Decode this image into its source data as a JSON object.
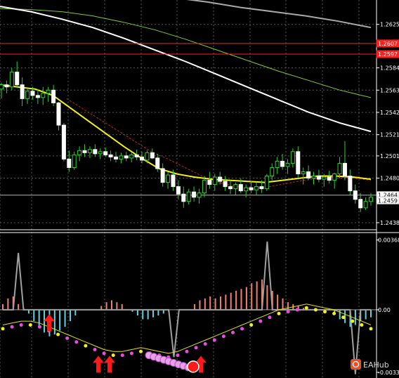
{
  "chart_data": {
    "type": "candlestick",
    "price_axis": {
      "ticks": [
        "1.2625",
        "1.2584",
        "1.2563",
        "1.2542",
        "1.2521",
        "1.2501",
        "1.2480",
        "1.2438"
      ],
      "tick_values": [
        1.2625,
        1.2584,
        1.2563,
        1.2542,
        1.2521,
        1.2501,
        1.248,
        1.2438
      ],
      "range": [
        1.2432,
        1.2648
      ],
      "level_tags": [
        {
          "text": "1.2607",
          "value": 1.2607,
          "color": "#ff2020"
        },
        {
          "text": "1.2597",
          "value": 1.2597,
          "color": "#ff2020"
        },
        {
          "text": "1.2464",
          "value": 1.2464,
          "color": "#ffffff"
        },
        {
          "text": "1.2459",
          "value": 1.2459,
          "color": "#ffffff"
        }
      ]
    },
    "indicator_axis": {
      "ticks": [
        "0.00368",
        "0.00",
        "-0.0033"
      ],
      "tick_values": [
        0.00368,
        0.0,
        -0.0033
      ],
      "range": [
        -0.0036,
        0.004
      ]
    },
    "candles": [
      [
        1.2564,
        1.257,
        1.2555,
        1.2568
      ],
      [
        1.2568,
        1.2572,
        1.256,
        1.2566
      ],
      [
        1.2566,
        1.2584,
        1.2563,
        1.258
      ],
      [
        1.258,
        1.259,
        1.2565,
        1.2568
      ],
      [
        1.2568,
        1.2575,
        1.2548,
        1.2555
      ],
      [
        1.2555,
        1.2565,
        1.255,
        1.2562
      ],
      [
        1.2562,
        1.2566,
        1.2554,
        1.2558
      ],
      [
        1.2558,
        1.2564,
        1.255,
        1.2556
      ],
      [
        1.2556,
        1.2566,
        1.2549,
        1.256
      ],
      [
        1.256,
        1.2566,
        1.2552,
        1.2563
      ],
      [
        1.2563,
        1.2568,
        1.2548,
        1.2551
      ],
      [
        1.2551,
        1.2552,
        1.2525,
        1.253
      ],
      [
        1.253,
        1.2532,
        1.2496,
        1.2498
      ],
      [
        1.2498,
        1.2506,
        1.2486,
        1.249
      ],
      [
        1.249,
        1.2505,
        1.2488,
        1.2502
      ],
      [
        1.2502,
        1.251,
        1.2496,
        1.2506
      ],
      [
        1.2506,
        1.2512,
        1.25,
        1.2504
      ],
      [
        1.2504,
        1.251,
        1.2499,
        1.2507
      ],
      [
        1.2507,
        1.2512,
        1.25,
        1.2503
      ],
      [
        1.2503,
        1.2508,
        1.2498,
        1.2505
      ],
      [
        1.2505,
        1.2509,
        1.25,
        1.2502
      ],
      [
        1.2502,
        1.2506,
        1.2496,
        1.25
      ],
      [
        1.25,
        1.2505,
        1.2495,
        1.2498
      ],
      [
        1.2498,
        1.2504,
        1.2494,
        1.2501
      ],
      [
        1.2501,
        1.2505,
        1.2496,
        1.2499
      ],
      [
        1.2499,
        1.2504,
        1.2495,
        1.2502
      ],
      [
        1.2502,
        1.2507,
        1.2497,
        1.25
      ],
      [
        1.25,
        1.2505,
        1.2494,
        1.2497
      ],
      [
        1.2497,
        1.2506,
        1.2494,
        1.2504
      ],
      [
        1.2504,
        1.2508,
        1.2498,
        1.2499
      ],
      [
        1.2499,
        1.2503,
        1.2486,
        1.2489
      ],
      [
        1.2489,
        1.2494,
        1.2472,
        1.2476
      ],
      [
        1.2476,
        1.2486,
        1.247,
        1.2483
      ],
      [
        1.2483,
        1.2488,
        1.2468,
        1.2472
      ],
      [
        1.2472,
        1.2478,
        1.246,
        1.2465
      ],
      [
        1.2465,
        1.2472,
        1.2452,
        1.2458
      ],
      [
        1.2458,
        1.247,
        1.2455,
        1.2467
      ],
      [
        1.2467,
        1.2472,
        1.2458,
        1.2462
      ],
      [
        1.2462,
        1.247,
        1.2456,
        1.2466
      ],
      [
        1.2466,
        1.2482,
        1.2462,
        1.2478
      ],
      [
        1.2478,
        1.2486,
        1.247,
        1.2474
      ],
      [
        1.2474,
        1.2484,
        1.2468,
        1.2481
      ],
      [
        1.2481,
        1.2486,
        1.2474,
        1.2477
      ],
      [
        1.2477,
        1.2482,
        1.2468,
        1.2472
      ],
      [
        1.2472,
        1.2478,
        1.2465,
        1.247
      ],
      [
        1.247,
        1.2476,
        1.2464,
        1.2474
      ],
      [
        1.2474,
        1.248,
        1.2466,
        1.2468
      ],
      [
        1.2468,
        1.2474,
        1.2462,
        1.2471
      ],
      [
        1.2471,
        1.2477,
        1.2466,
        1.2469
      ],
      [
        1.2469,
        1.2476,
        1.2464,
        1.2472
      ],
      [
        1.2472,
        1.2478,
        1.2466,
        1.247
      ],
      [
        1.247,
        1.2484,
        1.2468,
        1.2482
      ],
      [
        1.2482,
        1.2494,
        1.2478,
        1.249
      ],
      [
        1.249,
        1.25,
        1.2484,
        1.2496
      ],
      [
        1.2496,
        1.2503,
        1.2488,
        1.2491
      ],
      [
        1.2491,
        1.2498,
        1.2484,
        1.2494
      ],
      [
        1.2494,
        1.2508,
        1.249,
        1.2505
      ],
      [
        1.2505,
        1.251,
        1.248,
        1.2484
      ],
      [
        1.2484,
        1.249,
        1.2474,
        1.2486
      ],
      [
        1.2486,
        1.2492,
        1.2478,
        1.248
      ],
      [
        1.248,
        1.2486,
        1.2474,
        1.2482
      ],
      [
        1.2482,
        1.2488,
        1.2476,
        1.2479
      ],
      [
        1.2479,
        1.2484,
        1.2472,
        1.2481
      ],
      [
        1.2481,
        1.2487,
        1.2475,
        1.2478
      ],
      [
        1.2478,
        1.2485,
        1.247,
        1.2484
      ],
      [
        1.2484,
        1.25,
        1.248,
        1.2494
      ],
      [
        1.2494,
        1.2515,
        1.2478,
        1.2482
      ],
      [
        1.2482,
        1.2488,
        1.2464,
        1.2468
      ],
      [
        1.2468,
        1.2474,
        1.2456,
        1.246
      ],
      [
        1.246,
        1.2466,
        1.2448,
        1.2452
      ],
      [
        1.2452,
        1.2462,
        1.245,
        1.2458
      ],
      [
        1.2458,
        1.2466,
        1.2454,
        1.2462
      ]
    ],
    "ema_white": [
      1.2642,
      1.2637,
      1.263,
      1.2622,
      1.2612,
      1.2601,
      1.259,
      1.2578,
      1.2566,
      1.2554,
      1.2542,
      1.2532,
      1.2524
    ],
    "sma_green": [
      1.264,
      1.2639,
      1.2637,
      1.2633,
      1.2627,
      1.262,
      1.2611,
      1.2601,
      1.2591,
      1.2581,
      1.2572,
      1.2563,
      1.2556
    ],
    "sma_gray": [
      1.265,
      1.2646,
      1.2641,
      1.2637,
      1.2633,
      1.2628,
      1.2622
    ],
    "ma_yellow": [
      1.2568,
      1.2566,
      1.2564,
      1.2558,
      1.2546,
      1.2534,
      1.2522,
      1.251,
      1.2499,
      1.2489,
      1.2484,
      1.2481,
      1.2479,
      1.2478,
      1.2477,
      1.2476,
      1.2478,
      1.248,
      1.2482,
      1.2482,
      1.2481,
      1.2479
    ],
    "ma_red_dashed": [
      1.2555,
      1.2545,
      1.2535,
      1.2525,
      1.2515,
      1.2505,
      1.2498,
      1.249,
      1.2482,
      1.2476,
      1.2472,
      1.247,
      1.2472,
      1.2475,
      1.2478,
      1.248,
      1.2481,
      1.248,
      1.2478
    ],
    "histogram": [
      0.0003,
      0.0006,
      0.0007,
      0.0003,
      0.0001,
      -0.0002,
      -0.0006,
      -0.0009,
      -0.0012,
      -0.0014,
      -0.0013,
      -0.0011,
      -0.0009,
      -0.0006,
      -0.0003,
      0,
      0,
      0,
      0,
      0.0002,
      0.0004,
      0.0005,
      0.0004,
      0.0003,
      0,
      -0.0001,
      -0.0003,
      -0.0005,
      -0.0005,
      -0.0004,
      -0.0003,
      -0.0002,
      -0.0001,
      0,
      0,
      0,
      0,
      0.0003,
      0.0005,
      0.0006,
      0.0007,
      0.0006,
      0.0007,
      0.0008,
      0.0009,
      0.001,
      0.0011,
      0.0012,
      0.0014,
      0.0015,
      0.0016,
      0.0013,
      0.001,
      0.0008,
      0.0006,
      0.0004,
      0.0003,
      0.0002,
      0.0001,
      0,
      0,
      0,
      0,
      0,
      -0.0002,
      -0.0005,
      -0.0007,
      -0.0009,
      -0.0008,
      -0.0006,
      -0.0005,
      -0.0004
    ],
    "osc_line": [
      0,
      0,
      0,
      0.003,
      0,
      0,
      0,
      0,
      0,
      0,
      0,
      0,
      0,
      0,
      0,
      0,
      0,
      0,
      0,
      0,
      0,
      0,
      0,
      0,
      0,
      0,
      0,
      0,
      0,
      0,
      0,
      0,
      0,
      -0.0025,
      0,
      0,
      0,
      0,
      0,
      0,
      0,
      0,
      0,
      0,
      0,
      0,
      0,
      0,
      0,
      0,
      0,
      0.0036,
      0,
      0,
      0,
      0,
      0,
      0,
      0,
      0,
      0,
      0,
      0,
      0,
      0,
      0,
      0,
      0,
      -0.0034,
      0,
      0,
      0
    ],
    "signal_dots": [
      -0.001,
      -0.0009,
      -0.0008,
      -0.0008,
      -0.0009,
      -0.0011,
      -0.0013,
      -0.0015,
      -0.0017,
      -0.0019,
      -0.0021,
      -0.0023,
      -0.0024,
      -0.0024,
      -0.0023,
      -0.0022,
      -0.0023,
      -0.0024,
      -0.0025,
      -0.0024,
      -0.0022,
      -0.002,
      -0.0018,
      -0.0016,
      -0.0014,
      -0.0012,
      -0.001,
      -0.0008,
      -0.0006,
      -0.0004,
      -0.0002,
      -0.0001,
      0,
      0.0001,
      0,
      -0.0001,
      -0.0002,
      -0.0004,
      -0.0006,
      -0.0008,
      -0.001
    ],
    "buy_arrows": 5,
    "watermark": "EAHub"
  }
}
